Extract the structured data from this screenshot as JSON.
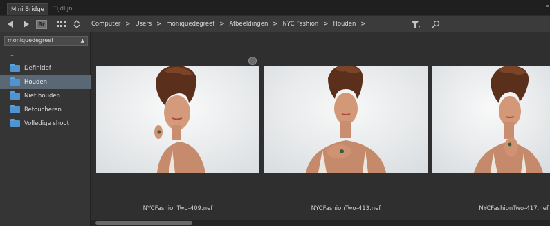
{
  "tabs": [
    {
      "label": "Mini Bridge",
      "active": true
    },
    {
      "label": "Tijdlijn",
      "active": false
    }
  ],
  "toolbar": {
    "br_label": "Br",
    "breadcrumbs": [
      "Computer",
      "Users",
      "moniquedegreef",
      "Afbeeldingen",
      "NYC Fashion",
      "Houden"
    ],
    "search": {
      "value": "",
      "placeholder": ""
    }
  },
  "sidebar": {
    "location": "moniquedegreef",
    "parent_label": "..",
    "folders": [
      {
        "label": "Definitief",
        "selected": false
      },
      {
        "label": "Houden",
        "selected": true
      },
      {
        "label": "Niet houden",
        "selected": false
      },
      {
        "label": "Retoucheren",
        "selected": false
      },
      {
        "label": "Volledige shoot",
        "selected": false
      }
    ]
  },
  "thumbnails": [
    {
      "filename": "NYCFashionTwo-409.nef"
    },
    {
      "filename": "NYCFashionTwo-413.nef"
    },
    {
      "filename": "NYCFashionTwo-417.nef"
    }
  ],
  "colors": {
    "folder": "#4f94d1",
    "selection": "#5a6876",
    "background": "#2f2f2f"
  },
  "icons": [
    "back-arrow-icon",
    "forward-arrow-icon",
    "view-mode-icon",
    "sort-icon",
    "filter-icon",
    "search-icon",
    "folder-icon",
    "rotate-icon"
  ]
}
